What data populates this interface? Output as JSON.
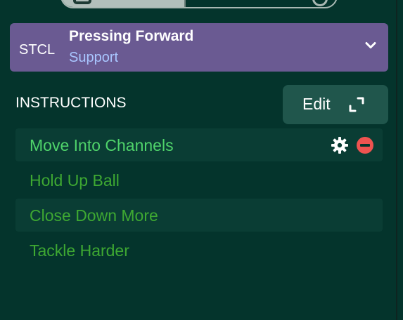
{
  "colors": {
    "background": "#04342c",
    "role_card": "#6a5a92",
    "role_duty_text": "#a9c6ff",
    "edit_button": "#20564c",
    "instruction_text": "#3ea832",
    "instruction_active_text": "#4fd36a",
    "remove_icon": "#ef5350"
  },
  "role": {
    "code": "STCL",
    "title": "Pressing Forward",
    "duty": "Support",
    "dropdown_icon": "chevron-down-icon"
  },
  "instructions": {
    "heading": "INSTRUCTIONS",
    "edit_label": "Edit",
    "edit_icon": "expand-icon",
    "items": [
      {
        "label": "Move Into Channels",
        "active": true
      },
      {
        "label": "Hold Up Ball",
        "active": false
      },
      {
        "label": "Close Down More",
        "active": false
      },
      {
        "label": "Tackle Harder",
        "active": false
      }
    ]
  }
}
